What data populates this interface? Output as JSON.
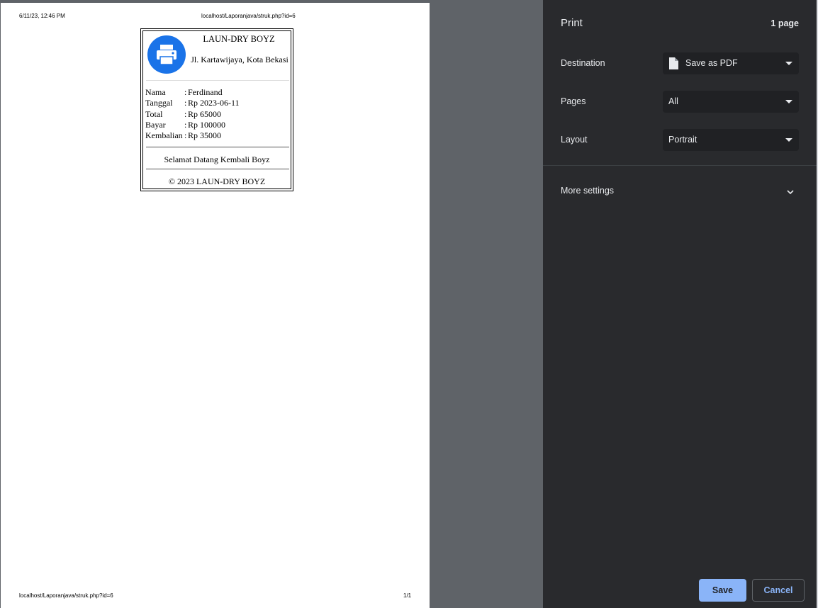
{
  "preview": {
    "header_datetime": "6/11/23, 12:46 PM",
    "header_url": "localhost/Laporanjava/struk.php?id=6",
    "footer_url": "localhost/Laporanjava/struk.php?id=6",
    "footer_page": "1/1",
    "receipt": {
      "shop_name": "LAUN-DRY BOYZ",
      "address": "Jl. Kartawijaya, Kota Bekasi",
      "logo_icon": "printer-icon",
      "rows": [
        {
          "label": "Nama",
          "colon": ":",
          "value": "Ferdinand"
        },
        {
          "label": "Tanggal",
          "colon": ":",
          "value": "Rp 2023-06-11"
        },
        {
          "label": "Total",
          "colon": ":",
          "value": "Rp 65000"
        },
        {
          "label": "Bayar",
          "colon": ":",
          "value": "Rp 100000"
        },
        {
          "label": "Kembalian",
          "colon": ":",
          "value": "Rp 35000"
        }
      ],
      "message": "Selamat Datang Kembali Boyz",
      "copyright": "© 2023 LAUN-DRY BOYZ"
    }
  },
  "sidebar": {
    "title": "Print",
    "page_count": "1 page",
    "destination": {
      "label": "Destination",
      "value": "Save as PDF"
    },
    "pages": {
      "label": "Pages",
      "value": "All"
    },
    "layout": {
      "label": "Layout",
      "value": "Portrait"
    },
    "more_settings": "More settings",
    "save_label": "Save",
    "cancel_label": "Cancel"
  },
  "colors": {
    "sidebar_bg": "#292a2d",
    "preview_bg": "#5f6368",
    "accent": "#8ab4f8",
    "logo_blue": "#1a73e8"
  }
}
